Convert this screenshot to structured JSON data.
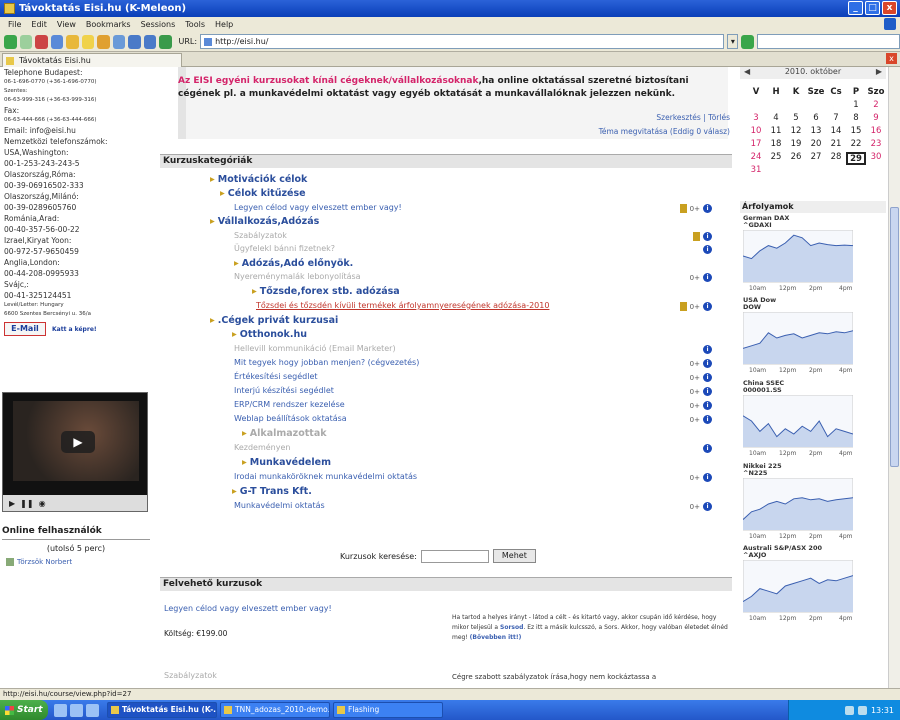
{
  "window": {
    "title": "Távoktatás Eisi.hu (K-Meleon)",
    "btn_min": "_",
    "btn_max": "□",
    "btn_close": "x"
  },
  "menu": [
    "File",
    "Edit",
    "View",
    "Bookmarks",
    "Sessions",
    "Tools",
    "Help"
  ],
  "toolbar": {
    "url_label": "URL:",
    "url": "http://eisi.hu/",
    "dropdown": "▾"
  },
  "tab": {
    "label": "Távoktatás Eisi.hu",
    "close": "x"
  },
  "left": {
    "lines": [
      {
        "t": "Telephone Budapest:",
        "s": "n"
      },
      {
        "t": "06-1-696-0770 (+36-1-696-0770)",
        "s": "s"
      },
      {
        "t": "Szentes:",
        "s": "s"
      },
      {
        "t": "06-63-999-316 (+36-63-999-316)",
        "s": "s"
      },
      {
        "t": "Fax:",
        "s": "n"
      },
      {
        "t": "06-63-444-666 (+36-63-444-666)",
        "s": "s"
      },
      {
        "t": "Email: info@eisi.hu",
        "s": "n"
      },
      {
        "t": "",
        "s": "n"
      },
      {
        "t": "Nemzetközi telefonszámok:",
        "s": "n"
      },
      {
        "t": "",
        "s": "n"
      },
      {
        "t": "USA,Washington:",
        "s": "n"
      },
      {
        "t": "00-1-253-243-243-5",
        "s": "n"
      },
      {
        "t": "Olaszország,Róma:",
        "s": "n"
      },
      {
        "t": "00-39-06916502-333",
        "s": "n"
      },
      {
        "t": "Olaszország,Milánó:",
        "s": "n"
      },
      {
        "t": "00-39-0289605760",
        "s": "n"
      },
      {
        "t": "Románia,Arad:",
        "s": "n"
      },
      {
        "t": "00-40-357-56-00-22",
        "s": "n"
      },
      {
        "t": "Izrael,Kiryat Yoon:",
        "s": "n"
      },
      {
        "t": "00-972-57-9650459",
        "s": "n"
      },
      {
        "t": "Anglia,London:",
        "s": "n"
      },
      {
        "t": "00-44-208-0995933",
        "s": "n"
      },
      {
        "t": "Svájc,:",
        "s": "n"
      },
      {
        "t": "00-41-325124451",
        "s": "n"
      },
      {
        "t": "",
        "s": "n"
      },
      {
        "t": "Levél/Letter: Hungary",
        "s": "s"
      },
      {
        "t": "6600 Szentes Bercsényi u. 36/a",
        "s": "s"
      }
    ],
    "email_btn": "E-Mail",
    "katt": "Katt a képre!",
    "online_title": "Online felhasználók",
    "online_sub": "(utolsó 5 perc)",
    "online_user": "Törzsök Norbert"
  },
  "center": {
    "note_red": "Az EISI egyéni kurzusokat kínál cégeknek/vállalkozásoknak",
    "note_rest": ",ha online oktatással szeretné biztosítani cégének pl. a munkavédelmi oktatást vagy egyéb oktatását a munkavállalóknak jelezzen nekünk.",
    "edit_links": "Szerkesztés | Törlés",
    "tema_links": "Téma megvitatása (Eddig 0 válasz)",
    "cat_head": "Kurzuskategóriák",
    "items": [
      {
        "k": "cat",
        "t": "Motivációk célok"
      },
      {
        "k": "cat",
        "t": "Célok kitűzése"
      },
      {
        "k": "course",
        "t": "Legyen célod vagy elveszett ember vagy!"
      },
      {
        "k": "cat",
        "t": "Vállalkozás,Adózás"
      },
      {
        "k": "dim",
        "t": "Szabályzatok"
      },
      {
        "k": "dim",
        "t": "Ügyfelekl bánni fizetnek?"
      },
      {
        "k": "cat",
        "t": "Adózás,Adó előnyök."
      },
      {
        "k": "dim",
        "t": "Nyereménymalák lebonyolítása"
      },
      {
        "k": "cat",
        "t": "Tőzsde,forex stb. adózása"
      },
      {
        "k": "red",
        "t": "Tőzsdei és tőzsdén kívüli termékek árfolyamnyereségének adózása-2010"
      },
      {
        "k": "cat",
        "t": ".Cégek privát kurzusai"
      },
      {
        "k": "cat",
        "t": "Otthonok.hu"
      },
      {
        "k": "dim",
        "t": "Hellevill kommunikáció (Email Marketer)"
      },
      {
        "k": "course",
        "t": "Mit tegyek hogy jobban menjen? (cégvezetés)"
      },
      {
        "k": "course",
        "t": "Értékesítési segédlet"
      },
      {
        "k": "course",
        "t": "Interjú készítési segédlet"
      },
      {
        "k": "course",
        "t": "ERP/CRM rendszer kezelése"
      },
      {
        "k": "course",
        "t": "Weblap beállítások oktatása"
      },
      {
        "k": "catdim",
        "t": "Alkalmazottak"
      },
      {
        "k": "dim",
        "t": "Kezdeményen"
      },
      {
        "k": "cat",
        "t": "Munkavédelem"
      },
      {
        "k": "course",
        "t": "Irodai munkaköröknek munkavédelmi oktatás"
      },
      {
        "k": "cat",
        "t": "G-T Trans Kft."
      },
      {
        "k": "course",
        "t": "Munkavédelmi oktatás"
      }
    ],
    "key_label": "0+",
    "info_label": "i",
    "search_label": "Kurzusok keresése:",
    "search_btn": "Mehet",
    "felv_head": "Felvehető kurzusok",
    "felv_title": "Legyen célod vagy elveszett ember vagy!",
    "felv_cost": "Költség: €199.00",
    "felv_desc_1": "Ha tartod a helyes irányt - látod a célt - és kitartó vagy, akkor csupán idő kérdése, hogy mikor teljesül a",
    "felv_desc_b": "Sorsod",
    "felv_desc_2": ". Ez itt a másik kulcsszó, a Sors. Akkor, hogy valóban életedet élnéd meg!",
    "felv_desc_link": "(Bővebben itt!)",
    "szab": "Szabályzatok",
    "szab_desc": "Cégre szabott szabályzatok írása,hogy nem kockáztassa a"
  },
  "calendar": {
    "prev": "◀",
    "month": "2010. október",
    "next": "▶",
    "days": [
      "V",
      "H",
      "K",
      "Sze",
      "Cs",
      "P",
      "Szo"
    ],
    "weeks": [
      [
        "",
        "",
        "",
        "",
        "",
        "1",
        "2"
      ],
      [
        "3",
        "4",
        "5",
        "6",
        "7",
        "8",
        "9"
      ],
      [
        "10",
        "11",
        "12",
        "13",
        "14",
        "15",
        "16"
      ],
      [
        "17",
        "18",
        "19",
        "20",
        "21",
        "22",
        "23"
      ],
      [
        "24",
        "25",
        "26",
        "27",
        "28",
        "29",
        "30"
      ],
      [
        "31",
        "",
        "",
        "",
        "",
        "",
        ""
      ]
    ],
    "today": "29"
  },
  "stocks": {
    "title": "Árfolyamok",
    "items": [
      {
        "name": "German DAX",
        "sym": "^GDAXI",
        "pts": [
          0.5,
          0.45,
          0.6,
          0.7,
          0.65,
          0.75,
          0.9,
          0.85,
          0.7,
          0.75,
          0.72,
          0.7,
          0.71,
          0.7
        ]
      },
      {
        "name": "USA Dow",
        "sym": "DOW",
        "pts": [
          0.3,
          0.35,
          0.4,
          0.6,
          0.5,
          0.55,
          0.58,
          0.5,
          0.55,
          0.6,
          0.58,
          0.62,
          0.6,
          0.64
        ]
      },
      {
        "name": "China SSEC",
        "sym": "000001.SS",
        "pts": [
          0.6,
          0.5,
          0.3,
          0.45,
          0.2,
          0.35,
          0.25,
          0.4,
          0.3,
          0.5,
          0.2,
          0.35,
          0.3,
          0.25
        ]
      },
      {
        "name": "Nikkei 225",
        "sym": "^N225",
        "pts": [
          0.2,
          0.35,
          0.4,
          0.5,
          0.55,
          0.5,
          0.6,
          0.62,
          0.58,
          0.6,
          0.55,
          0.58,
          0.6,
          0.62
        ]
      },
      {
        "name": "Australi S&P/ASX 200",
        "sym": "^AXJO",
        "pts": [
          0.2,
          0.3,
          0.45,
          0.4,
          0.35,
          0.5,
          0.55,
          0.6,
          0.65,
          0.55,
          0.62,
          0.6,
          0.65,
          0.7
        ]
      }
    ],
    "x_ticks": [
      "10am",
      "12pm",
      "2pm",
      "4pm"
    ]
  },
  "status": {
    "text": "http://eisi.hu/course/view.php?id=27"
  },
  "taskbar": {
    "start": "Start",
    "tasks": [
      "Távoktatás Eisi.hu (K-...",
      "TNN_adozas_2010-demo...",
      "Flashing"
    ],
    "clock": "13:31"
  }
}
